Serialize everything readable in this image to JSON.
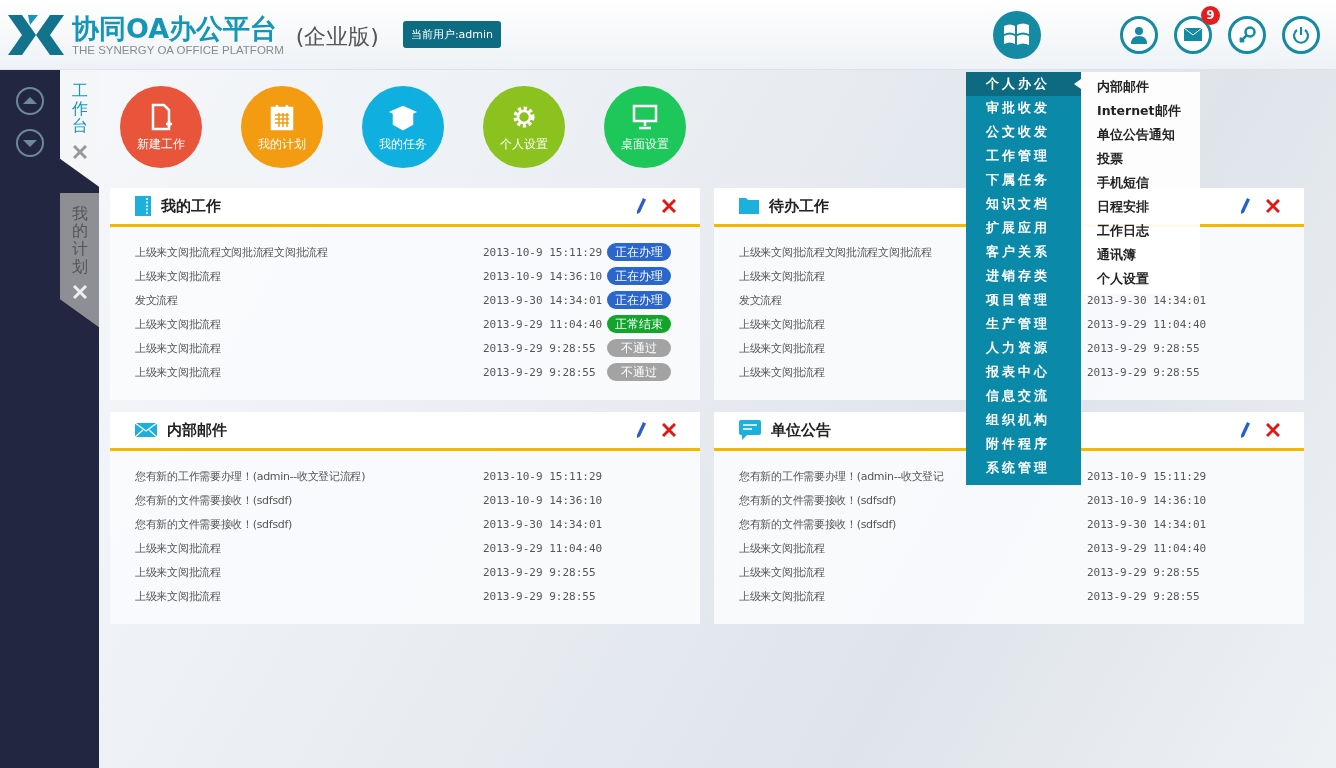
{
  "header": {
    "title": "协同OA办公平台",
    "subtitle": "THE SYNERGY OA OFFICE PLATFORM",
    "edition": "(企业版)",
    "current_user": "当前用户:admin",
    "mail_count": "9"
  },
  "side_tabs": [
    {
      "label": "工作台",
      "selected": true
    },
    {
      "label": "我的计划",
      "selected": false
    }
  ],
  "shortcuts": [
    {
      "label": "新建工作",
      "kind": "new-file",
      "color": "#e8553a"
    },
    {
      "label": "我的计划",
      "kind": "calendar",
      "color": "#f39c12"
    },
    {
      "label": "我的任务",
      "kind": "box",
      "color": "#0fb0e0"
    },
    {
      "label": "个人设置",
      "kind": "gear",
      "color": "#8cc21f"
    },
    {
      "label": "桌面设置",
      "kind": "monitor",
      "color": "#1ec75a"
    }
  ],
  "panels": [
    {
      "title": "我的工作",
      "kind": "book",
      "rows": [
        {
          "title": "上级来文阅批流程文阅批流程文阅批流程",
          "time": "2013-10-9 15:11:29",
          "status": {
            "label": "正在办理",
            "color": "#2a66cc"
          }
        },
        {
          "title": "上级来文阅批流程",
          "time": "2013-10-9 14:36:10",
          "status": {
            "label": "正在办理",
            "color": "#2a66cc"
          }
        },
        {
          "title": "发文流程",
          "time": "2013-9-30 14:34:01",
          "status": {
            "label": "正在办理",
            "color": "#2a66cc"
          }
        },
        {
          "title": "上级来文阅批流程",
          "time": "2013-9-29 11:04:40",
          "status": {
            "label": "正常结束",
            "color": "#13a52b"
          }
        },
        {
          "title": "上级来文阅批流程",
          "time": "2013-9-29 9:28:55",
          "status": {
            "label": "不通过",
            "color": "#a3a3a3"
          }
        },
        {
          "title": "上级来文阅批流程",
          "time": "2013-9-29 9:28:55",
          "status": {
            "label": "不通过",
            "color": "#a3a3a3"
          }
        }
      ]
    },
    {
      "title": "待办工作",
      "kind": "folder",
      "rows": [
        {
          "title": "上级来文阅批流程文阅批流程文阅批流程"
        },
        {
          "title": "上级来文阅批流程"
        },
        {
          "title": "发文流程",
          "time": "2013-9-30 14:34:01"
        },
        {
          "title": "上级来文阅批流程",
          "time": "2013-9-29 11:04:40"
        },
        {
          "title": "上级来文阅批流程",
          "time": "2013-9-29 9:28:55"
        },
        {
          "title": "上级来文阅批流程",
          "time": "2013-9-29 9:28:55"
        }
      ]
    },
    {
      "title": "内部邮件",
      "kind": "mail",
      "rows": [
        {
          "title": "您有新的工作需要办理！(admin--收文登记流程)",
          "time": "2013-10-9 15:11:29"
        },
        {
          "title": "您有新的文件需要接收！(sdfsdf)",
          "time": "2013-10-9 14:36:10"
        },
        {
          "title": "您有新的文件需要接收！(sdfsdf)",
          "time": "2013-9-30 14:34:01"
        },
        {
          "title": "上级来文阅批流程",
          "time": "2013-9-29 11:04:40"
        },
        {
          "title": "上级来文阅批流程",
          "time": "2013-9-29 9:28:55"
        },
        {
          "title": "上级来文阅批流程",
          "time": "2013-9-29 9:28:55"
        }
      ]
    },
    {
      "title": "单位公告",
      "kind": "chat",
      "rows": [
        {
          "title": "您有新的工作需要办理！(admin--收文登记",
          "time": "2013-10-9 15:11:29"
        },
        {
          "title": "您有新的文件需要接收！(sdfsdf)",
          "time": "2013-10-9 14:36:10"
        },
        {
          "title": "您有新的文件需要接收！(sdfsdf)",
          "time": "2013-9-30 14:34:01"
        },
        {
          "title": "上级来文阅批流程",
          "time": "2013-9-29 11:04:40"
        },
        {
          "title": "上级来文阅批流程",
          "time": "2013-9-29 9:28:55"
        },
        {
          "title": "上级来文阅批流程",
          "time": "2013-9-29 9:28:55"
        }
      ]
    }
  ],
  "menu": {
    "items": [
      {
        "label": "个人办公",
        "selected": true
      },
      {
        "label": "审批收发",
        "selected": false
      },
      {
        "label": "公文收发",
        "selected": false
      },
      {
        "label": "工作管理",
        "selected": false
      },
      {
        "label": "下属任务",
        "selected": false
      },
      {
        "label": "知识文档",
        "selected": false
      },
      {
        "label": "扩展应用",
        "selected": false
      },
      {
        "label": "客户关系",
        "selected": false
      },
      {
        "label": "进销存类",
        "selected": false
      },
      {
        "label": "项目管理",
        "selected": false
      },
      {
        "label": "生产管理",
        "selected": false
      },
      {
        "label": "人力资源",
        "selected": false
      },
      {
        "label": "报表中心",
        "selected": false
      },
      {
        "label": "信息交流",
        "selected": false
      },
      {
        "label": "组织机构",
        "selected": false
      },
      {
        "label": "附件程序",
        "selected": false
      },
      {
        "label": "系统管理",
        "selected": false
      }
    ],
    "submenu": [
      "内部邮件",
      "Internet邮件",
      "单位公告通知",
      "投票",
      "手机短信",
      "日程安排",
      "工作日志",
      "通讯簿",
      "个人设置"
    ]
  }
}
